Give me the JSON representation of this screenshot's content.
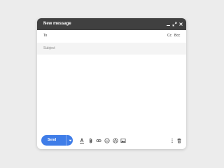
{
  "window": {
    "title": "New message",
    "controls": [
      "minimize-icon",
      "expand-icon",
      "close-icon"
    ]
  },
  "fields": {
    "to_label": "To",
    "cc_label": "Cc",
    "bcc_label": "Bcc",
    "subject_placeholder": "Subject"
  },
  "toolbar": {
    "send_label": "Send",
    "icons": [
      "text-format-icon",
      "attach-icon",
      "link-icon",
      "emoji-icon",
      "drive-icon",
      "image-icon",
      "more-options-icon",
      "trash-icon"
    ]
  },
  "colors": {
    "titlebar": "#404040",
    "send_button": "#3f7de8",
    "subject_background": "#f4f4f4"
  }
}
